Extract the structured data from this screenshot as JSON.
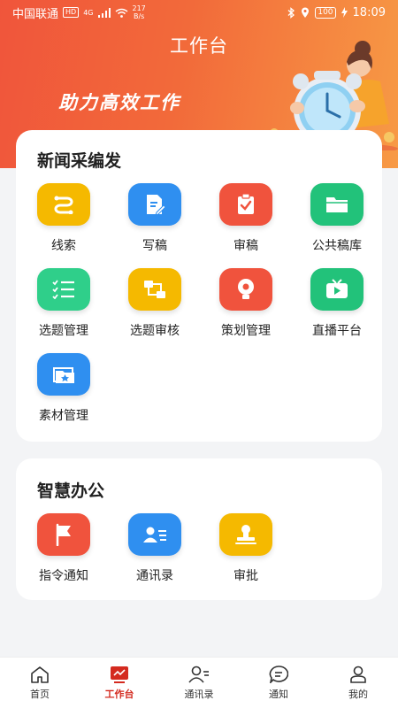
{
  "status_bar": {
    "carrier": "中国联通",
    "hd": "HD",
    "network": "4G",
    "speed": "217",
    "speed_unit": "B/s",
    "battery": "100",
    "time": "18:09"
  },
  "header": {
    "title": "工作台",
    "slogan": "助力高效工作"
  },
  "sections": [
    {
      "title": "新闻采编发",
      "items": [
        {
          "label": "线索",
          "icon": "link-icon",
          "color": "#f5b900"
        },
        {
          "label": "写稿",
          "icon": "document-edit-icon",
          "color": "#2f8ff0"
        },
        {
          "label": "审稿",
          "icon": "clipboard-check-icon",
          "color": "#f0533d"
        },
        {
          "label": "公共稿库",
          "icon": "folder-icon",
          "color": "#22c27a"
        },
        {
          "label": "选题管理",
          "icon": "checklist-icon",
          "color": "#2fcf8a"
        },
        {
          "label": "选题审核",
          "icon": "flow-review-icon",
          "color": "#f5b900"
        },
        {
          "label": "策划管理",
          "icon": "lightbulb-icon",
          "color": "#f0533d"
        },
        {
          "label": "直播平台",
          "icon": "tv-play-icon",
          "color": "#22c27a"
        },
        {
          "label": "素材管理",
          "icon": "media-folder-icon",
          "color": "#2f8ff0"
        }
      ]
    },
    {
      "title": "智慧办公",
      "items": [
        {
          "label": "指令通知",
          "icon": "flag-icon",
          "color": "#f0533d"
        },
        {
          "label": "通讯录",
          "icon": "contact-card-icon",
          "color": "#2f8ff0"
        },
        {
          "label": "审批",
          "icon": "stamp-icon",
          "color": "#f5b900"
        }
      ]
    }
  ],
  "tab_bar": [
    {
      "label": "首页",
      "icon": "home-icon",
      "active": false
    },
    {
      "label": "工作台",
      "icon": "workbench-chart-icon",
      "active": true
    },
    {
      "label": "通讯录",
      "icon": "contacts-icon",
      "active": false
    },
    {
      "label": "通知",
      "icon": "message-icon",
      "active": false
    },
    {
      "label": "我的",
      "icon": "user-icon",
      "active": false
    }
  ],
  "colors": {
    "header_start": "#f0553b",
    "header_end": "#f79a45",
    "active_tab": "#d42a1f"
  }
}
